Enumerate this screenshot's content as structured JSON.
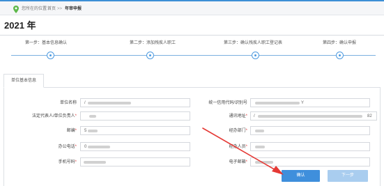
{
  "breadcrumb": {
    "location_label": "您所在的位置:",
    "home": "首页",
    "separator": ">>",
    "current": "年审申报"
  },
  "year_title": "2021 年",
  "steps": [
    {
      "label": "第一步：基本信息确认"
    },
    {
      "label": "第二步：添加残疾人职工"
    },
    {
      "label": "第三步：确认残疾人职工登记表"
    },
    {
      "label": "第四步：确认申报"
    }
  ],
  "tab": {
    "label": "单位基本信息"
  },
  "form": {
    "unit_name": {
      "label": "单位名称",
      "value": "/"
    },
    "credit_code": {
      "label": "统一信用代码/识别号",
      "value": "Y"
    },
    "legal_rep": {
      "label": "法定代表人/单位负责人",
      "value": ""
    },
    "address": {
      "label": "通讯地址",
      "value_start": "/",
      "value_end": "82"
    },
    "postcode": {
      "label": "邮编",
      "value": "5"
    },
    "department": {
      "label": "经办部门",
      "value": ""
    },
    "office_phone": {
      "label": "办公电话",
      "value": "0"
    },
    "handler": {
      "label": "经办人员",
      "value": ""
    },
    "mobile": {
      "label": "手机号码",
      "value": ""
    },
    "email": {
      "label": "电子邮箱",
      "value": ""
    },
    "required_mark": "*"
  },
  "buttons": {
    "confirm": "确认",
    "next": "下一步"
  },
  "colors": {
    "accent": "#3f8fdc",
    "accent_light": "#a9cdef",
    "pin": "#5db84a",
    "annotation": "#e53935"
  },
  "icons": {
    "location": "map-pin-icon"
  }
}
